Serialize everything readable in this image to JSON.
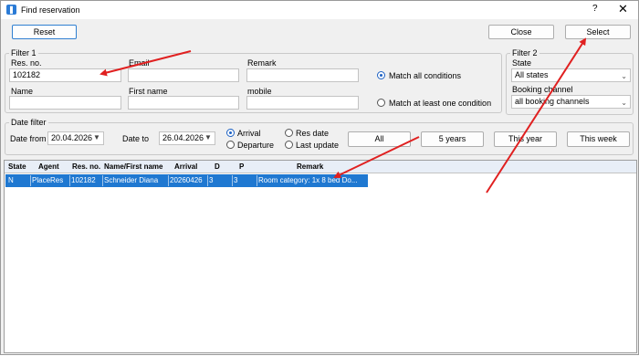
{
  "window": {
    "title": "Find reservation",
    "help_label": "?",
    "close_glyph": "✕"
  },
  "toolbar": {
    "reset_label": "Reset",
    "close_label": "Close",
    "select_label": "Select"
  },
  "filter1": {
    "legend": "Filter 1",
    "res_no_label": "Res. no.",
    "res_no_value": "102182",
    "email_label": "Email",
    "email_value": "",
    "remark_label": "Remark",
    "remark_value": "",
    "name_label": "Name",
    "name_value": "",
    "first_name_label": "First name",
    "first_name_value": "",
    "mobile_label": "mobile",
    "mobile_value": "",
    "match_all_label": "Match all conditions",
    "match_one_label": "Match at least one condition",
    "match_selected": "all"
  },
  "filter2": {
    "legend": "Filter 2",
    "state_label": "State",
    "state_value": "All states",
    "booking_channel_label": "Booking channel",
    "booking_channel_value": "all booking channels"
  },
  "date_filter": {
    "legend": "Date filter",
    "date_from_label": "Date from",
    "date_from_value": "20.04.2026",
    "date_to_label": "Date to",
    "date_to_value": "26.04.2026",
    "arrival_label": "Arrival",
    "departure_label": "Departure",
    "res_date_label": "Res date",
    "last_update_label": "Last update",
    "selected_type": "Arrival",
    "btn_all": "All",
    "btn_5years": "5 years",
    "btn_this_year": "This year",
    "btn_this_week": "This week"
  },
  "table": {
    "columns": [
      "State",
      "Agent",
      "Res. no.",
      "Name/First name",
      "Arrival",
      "D",
      "P",
      "Remark"
    ],
    "rows": [
      {
        "state": "N",
        "agent": "PlaceRes",
        "res_no": "102182",
        "name": "Schneider Diana",
        "arrival": "20260426",
        "d": "3",
        "p": "3",
        "remark": "Room category: 1x 8 bed Do..."
      }
    ]
  },
  "colors": {
    "selection": "#1f78d1",
    "annotation_arrow": "#e02020"
  }
}
